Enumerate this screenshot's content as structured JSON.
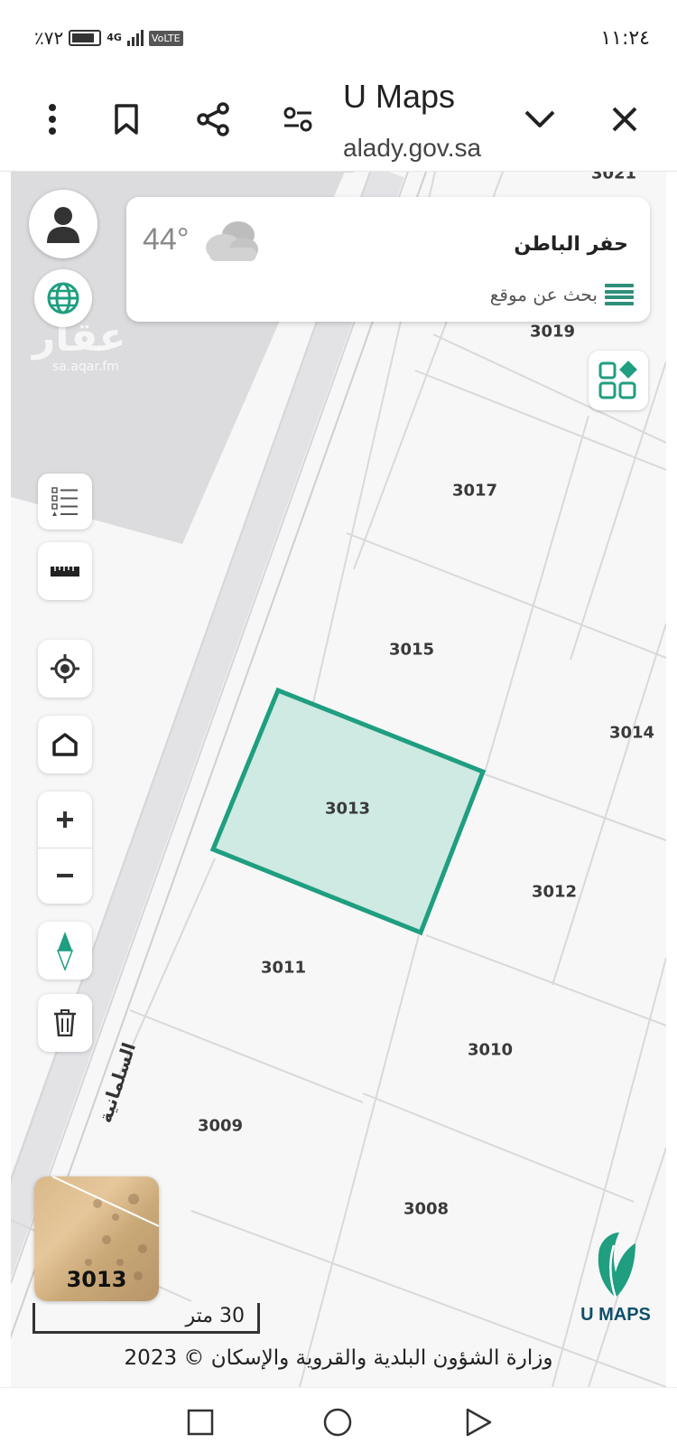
{
  "status_bar": {
    "battery": "٪٧٢",
    "network": "4G",
    "volte": "VoLTE",
    "time": "١١:٢٤"
  },
  "browser": {
    "title": "U Maps",
    "url": "alady.gov.sa"
  },
  "search_card": {
    "temperature": "44°",
    "city": "حفر الباطن",
    "search_label": "بحث عن موقع"
  },
  "watermark": {
    "brand": "عقار",
    "url": "sa.aqar.fm"
  },
  "map": {
    "street": "السلمانية",
    "parcels": [
      "3021",
      "3019",
      "3017",
      "3015",
      "3014",
      "3013",
      "3012",
      "3011",
      "3010",
      "3009",
      "3008"
    ],
    "selected_parcel": "3013",
    "accent": "#1f9e80"
  },
  "thumbnail": {
    "label": "3013"
  },
  "scale": {
    "label": "30 متر"
  },
  "logo": {
    "text": "U MAPS"
  },
  "footer": {
    "copyright": "وزارة الشؤون البلدية والقروية والإسكان © 2023"
  }
}
